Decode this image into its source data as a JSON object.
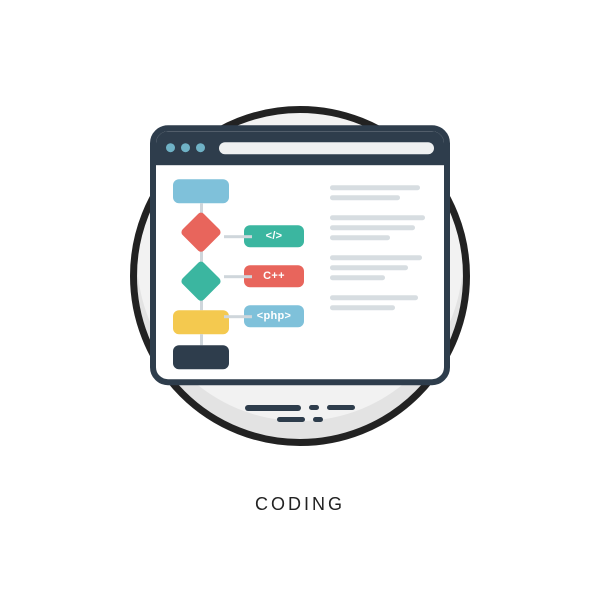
{
  "caption": "CODING",
  "tags": {
    "html": "</>",
    "cpp": "C++",
    "php": "<php>"
  }
}
